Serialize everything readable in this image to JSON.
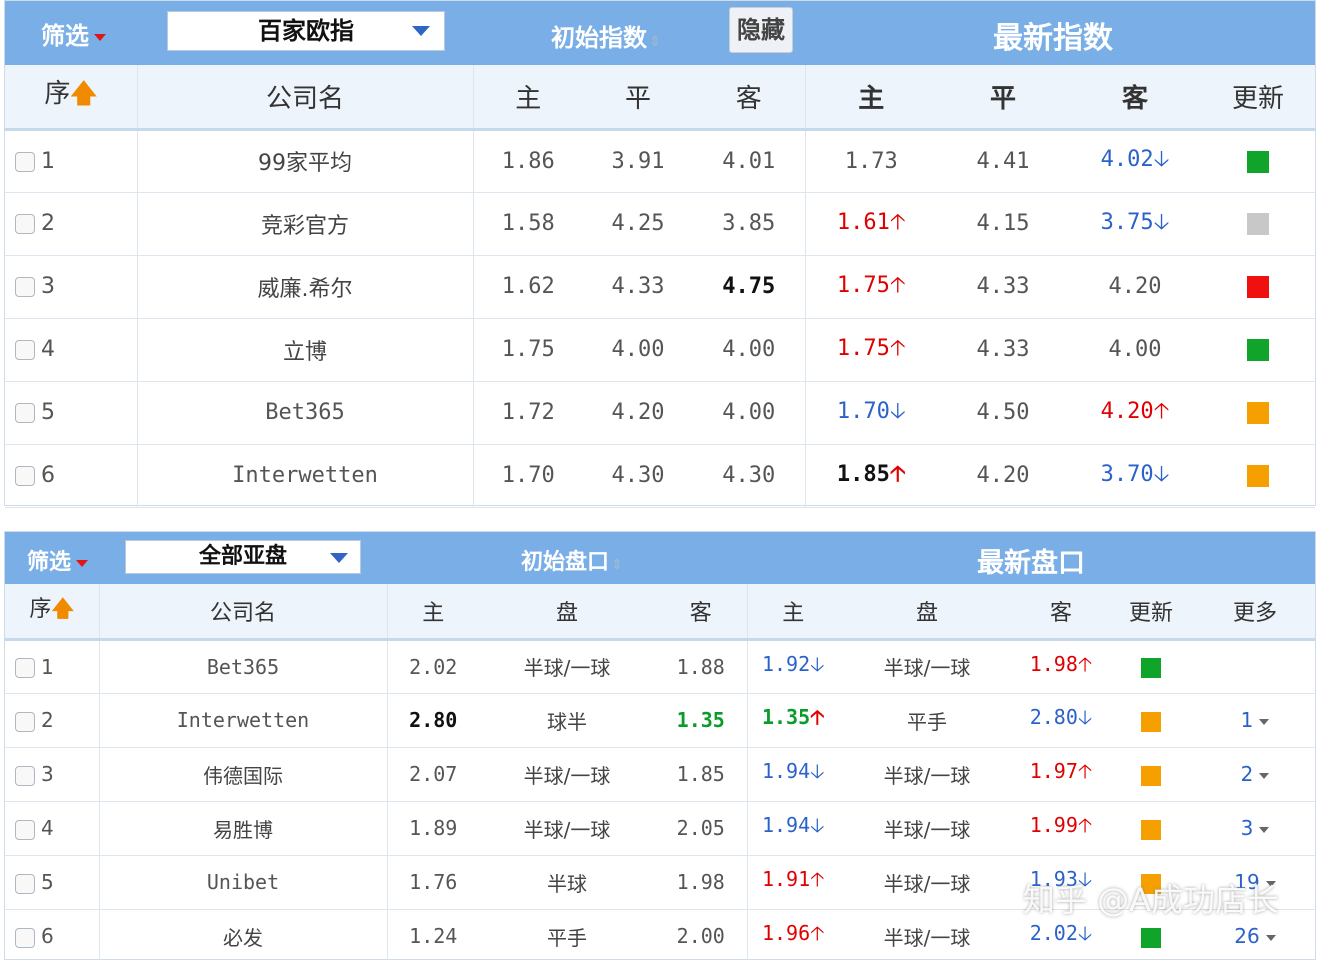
{
  "panel1": {
    "filter_label": "筛选",
    "select_value": "百家欧指",
    "initial_label": "初始指数",
    "hide_button": "隐藏",
    "latest_label": "最新指数",
    "headers": [
      "序",
      "公司名",
      "主",
      "平",
      "客",
      "主",
      "平",
      "客",
      "更新"
    ],
    "rows": [
      {
        "seq": "1",
        "company": "99家平均",
        "i_home": "1.86",
        "i_draw": "3.91",
        "i_away": "4.01",
        "l_home": "1.73",
        "l_draw": "4.41",
        "l_away": "4.02",
        "update_color": "#10a52a"
      },
      {
        "seq": "2",
        "company": "竞彩官方",
        "i_home": "1.58",
        "i_draw": "4.25",
        "i_away": "3.85",
        "l_home": "1.61",
        "l_draw": "4.15",
        "l_away": "3.75",
        "update_color": "#c8c8c8"
      },
      {
        "seq": "3",
        "company": "威廉.希尔",
        "i_home": "1.62",
        "i_draw": "4.33",
        "i_away": "4.75",
        "l_home": "1.75",
        "l_draw": "4.33",
        "l_away": "4.20",
        "update_color": "#f01010"
      },
      {
        "seq": "4",
        "company": "立博",
        "i_home": "1.75",
        "i_draw": "4.00",
        "i_away": "4.00",
        "l_home": "1.75",
        "l_draw": "4.33",
        "l_away": "4.00",
        "update_color": "#10a52a"
      },
      {
        "seq": "5",
        "company": "Bet365",
        "i_home": "1.72",
        "i_draw": "4.20",
        "i_away": "4.00",
        "l_home": "1.70",
        "l_draw": "4.50",
        "l_away": "4.20",
        "update_color": "#f5a000"
      },
      {
        "seq": "6",
        "company": "Interwetten",
        "i_home": "1.70",
        "i_draw": "4.30",
        "i_away": "4.30",
        "l_home": "1.85",
        "l_draw": "4.20",
        "l_away": "3.70",
        "update_color": "#f5a000"
      }
    ]
  },
  "panel2": {
    "filter_label": "筛选",
    "select_value": "全部亚盘",
    "initial_label": "初始盘口",
    "latest_label": "最新盘口",
    "headers": [
      "序",
      "公司名",
      "主",
      "盘",
      "客",
      "主",
      "盘",
      "客",
      "更新",
      "更多"
    ],
    "rows": [
      {
        "seq": "1",
        "company": "Bet365",
        "i_home": "2.02",
        "i_line": "半球/一球",
        "i_away": "1.88",
        "l_home": "1.92",
        "l_line": "半球/一球",
        "l_away": "1.98",
        "update_color": "#10a52a",
        "more": ""
      },
      {
        "seq": "2",
        "company": "Interwetten",
        "i_home": "2.80",
        "i_line": "球半",
        "i_away": "1.35",
        "l_home": "1.35",
        "l_line": "平手",
        "l_away": "2.80",
        "update_color": "#f5a000",
        "more": "1"
      },
      {
        "seq": "3",
        "company": "伟德国际",
        "i_home": "2.07",
        "i_line": "半球/一球",
        "i_away": "1.85",
        "l_home": "1.94",
        "l_line": "半球/一球",
        "l_away": "1.97",
        "update_color": "#f5a000",
        "more": "2"
      },
      {
        "seq": "4",
        "company": "易胜博",
        "i_home": "1.89",
        "i_line": "半球/一球",
        "i_away": "2.05",
        "l_home": "1.94",
        "l_line": "半球/一球",
        "l_away": "1.99",
        "update_color": "#f5a000",
        "more": "3"
      },
      {
        "seq": "5",
        "company": "Unibet",
        "i_home": "1.76",
        "i_line": "半球",
        "i_away": "1.98",
        "l_home": "1.91",
        "l_line": "半球/一球",
        "l_away": "1.93",
        "update_color": "#f5a000",
        "more": "19"
      },
      {
        "seq": "6",
        "company": "必发",
        "i_home": "1.24",
        "i_line": "平手",
        "i_away": "2.00",
        "l_home": "1.96",
        "l_line": "半球/一球",
        "l_away": "2.02",
        "update_color": "#10a52a",
        "more": "26"
      }
    ]
  },
  "watermark": "知乎 @A成功店长"
}
